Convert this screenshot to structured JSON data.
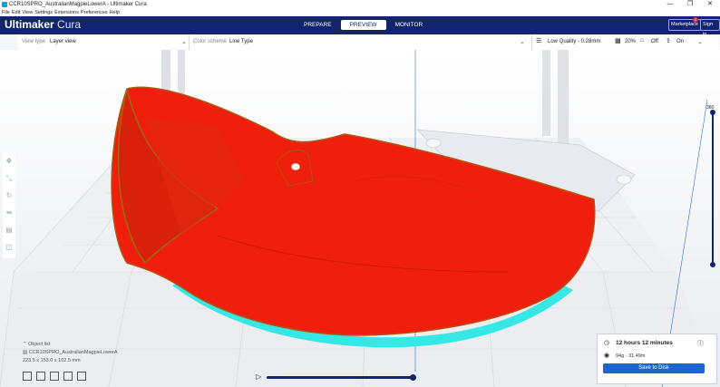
{
  "window": {
    "title": "CCR10SPRO_AustralianMagpieLowerA - Ultimaker Cura",
    "buttons": [
      "—",
      "❐",
      "✕"
    ]
  },
  "menu": [
    "File",
    "Edit",
    "View",
    "Settings",
    "Extensions",
    "Preferences",
    "Help"
  ],
  "header": {
    "brand_bold": "Ultimaker",
    "brand_light": "Cura",
    "tabs": [
      "PREPARE",
      "PREVIEW",
      "MONITOR"
    ],
    "active_tab": "PREVIEW",
    "marketplace_label": "Marketplace",
    "marketplace_badge": "1",
    "signin_label": "Sign in"
  },
  "toolbar": {
    "view_type_label": "View type",
    "view_type_value": "Layer view",
    "color_scheme_label": "Color scheme",
    "color_scheme_value": "Line Type",
    "quality": "Low Quality - 0.28mm",
    "infill": "20%",
    "support": "Off",
    "adhesion": "On"
  },
  "layer_slider": {
    "top_value": "360",
    "progress": 1.0
  },
  "object_list": {
    "header": "Object list",
    "file": "CCR10SPRO_AustralianMagpieLowerA",
    "dims": "223.5 x 153.0 x 102.5 mm"
  },
  "print_panel": {
    "time": "12 hours 12 minutes",
    "material": "94g · 31.49m",
    "button": "Save to Disk"
  },
  "colors": {
    "header": "#11246d",
    "model": "#f01e0c",
    "skirt": "#35e8e6",
    "accent": "#1b65d1"
  }
}
